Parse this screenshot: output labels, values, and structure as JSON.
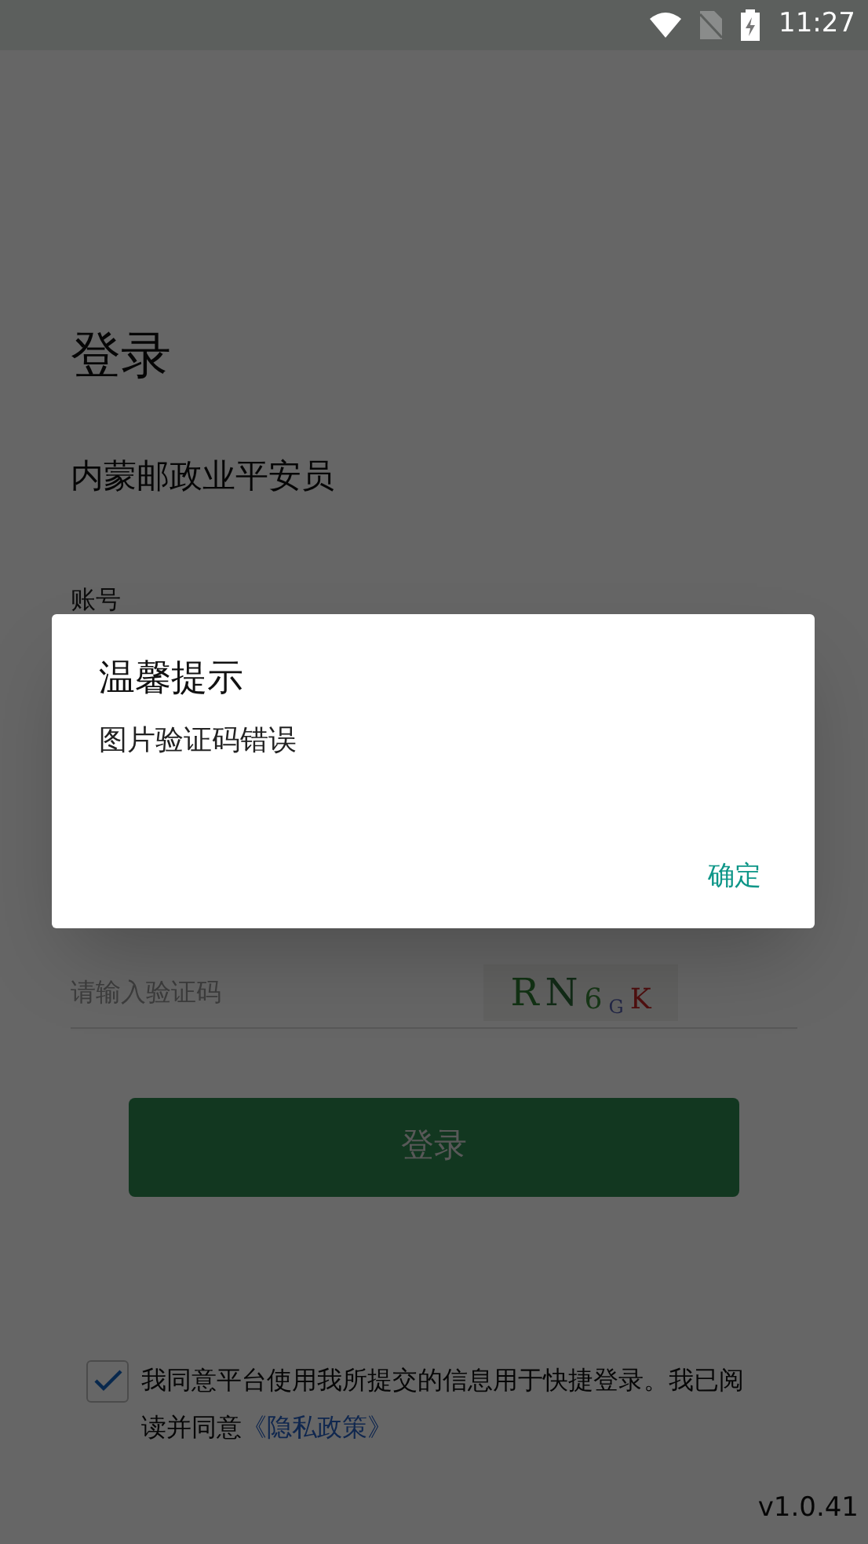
{
  "status_bar": {
    "time": "11:27"
  },
  "page": {
    "title": "登录",
    "subtitle": "内蒙邮政业平安员",
    "account_label": "账号",
    "captcha_field": {
      "placeholder": "请输入验证码"
    },
    "captcha_code": "RN6GK",
    "login_button": "登录"
  },
  "agreement": {
    "checked": true,
    "text": "我同意平台使用我所提交的信息用于快捷登录。我已阅读并同意",
    "link": "《隐私政策》"
  },
  "version": "v1.0.41",
  "dialog": {
    "title": "温馨提示",
    "message": "图片验证码错误",
    "buttons": [
      "确定"
    ]
  }
}
